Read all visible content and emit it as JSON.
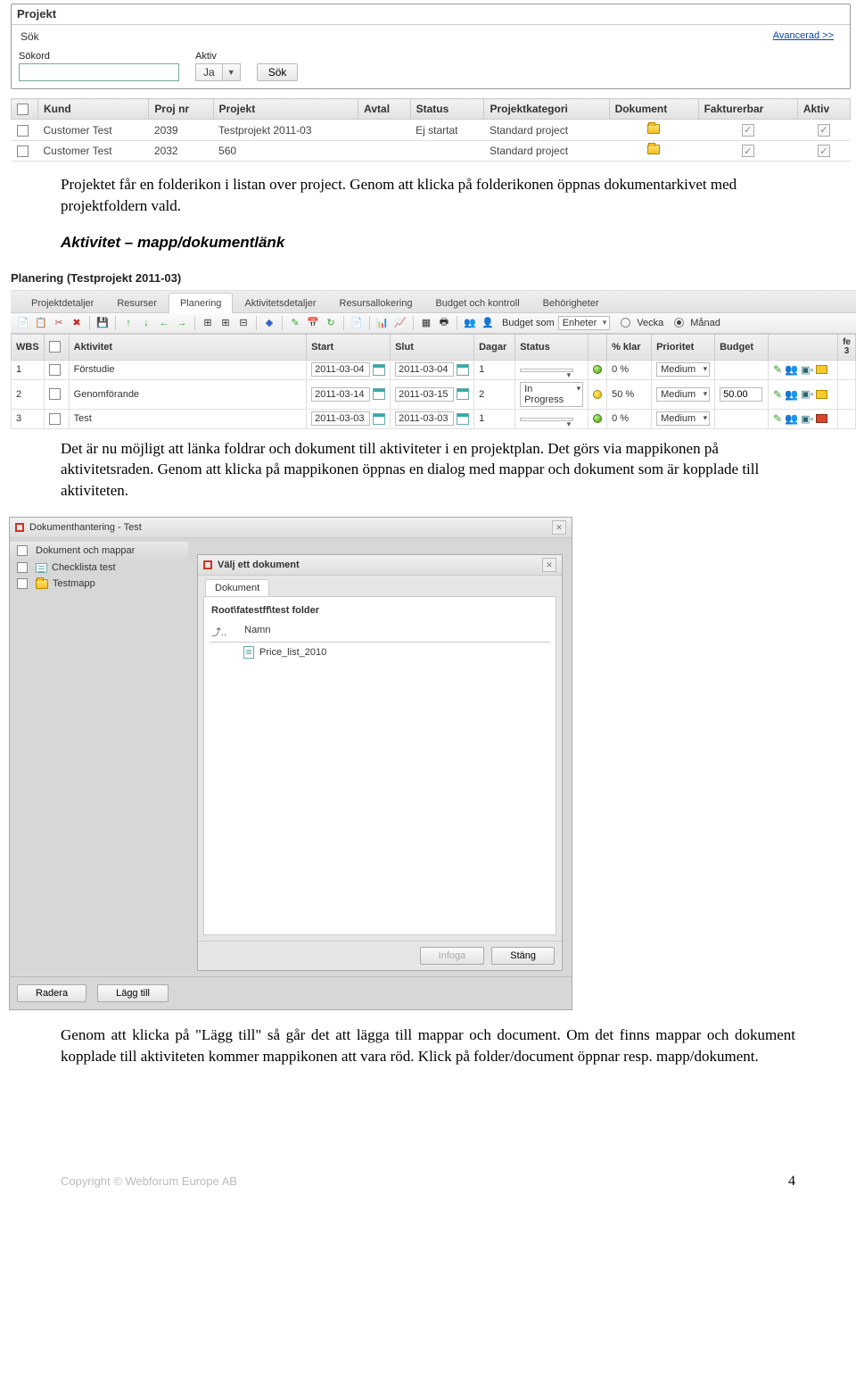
{
  "projekt_panel": {
    "title": "Projekt",
    "search_label": "Sök",
    "advanced_link": "Avancerad >>",
    "fields": {
      "sokord_label": "Sökord",
      "sokord_value": "",
      "aktiv_label": "Aktiv",
      "aktiv_value": "Ja",
      "sok_btn": "Sök"
    }
  },
  "projekt_table": {
    "headers": {
      "kund": "Kund",
      "projnr": "Proj nr",
      "projekt": "Projekt",
      "avtal": "Avtal",
      "status": "Status",
      "projektkategori": "Projektkategori",
      "dokument": "Dokument",
      "fakturerbar": "Fakturerbar",
      "aktiv": "Aktiv"
    },
    "rows": [
      {
        "kund": "Customer Test",
        "projnr": "2039",
        "projekt": "Testprojekt 2011-03",
        "avtal": "",
        "status": "Ej startat",
        "kategori": "Standard project"
      },
      {
        "kund": "Customer Test",
        "projnr": "2032",
        "projekt": "560",
        "avtal": "",
        "status": "",
        "kategori": "Standard project"
      }
    ]
  },
  "para1": "Projektet får en folderikon i listan over project. Genom att klicka på folderikonen öppnas dokumentarkivet med projektfoldern vald.",
  "heading_aktivitet": "Aktivitet – mapp/dokumentlänk",
  "planering": {
    "title": "Planering (Testprojekt 2011-03)",
    "tabs": [
      "Projektdetaljer",
      "Resurser",
      "Planering",
      "Aktivitetsdetaljer",
      "Resursallokering",
      "Budget och kontroll",
      "Behörigheter"
    ],
    "active_tab": 2,
    "toolbar": {
      "budget_label": "Budget som",
      "budget_value": "Enheter",
      "vecka": "Vecka",
      "manad": "Månad"
    },
    "grid": {
      "headers": {
        "wbs": "WBS",
        "aktivitet": "Aktivitet",
        "start": "Start",
        "slut": "Slut",
        "dagar": "Dagar",
        "status": "Status",
        "pklar": "% klar",
        "prioritet": "Prioritet",
        "budget": "Budget",
        "fe": "fe",
        "fe2": "3"
      },
      "rows": [
        {
          "wbs": "1",
          "akt": "Förstudie",
          "start": "2011-03-04",
          "slut": "2011-03-04",
          "dagar": "1",
          "status": "",
          "pklar": "0 %",
          "prio": "Medium",
          "budget": "",
          "folder": "y"
        },
        {
          "wbs": "2",
          "akt": "Genomförande",
          "start": "2011-03-14",
          "slut": "2011-03-15",
          "dagar": "2",
          "status": "In Progress",
          "pklar": "50 %",
          "prio": "Medium",
          "budget": "50.00",
          "folder": "y"
        },
        {
          "wbs": "3",
          "akt": "Test",
          "start": "2011-03-03",
          "slut": "2011-03-03",
          "dagar": "1",
          "status": "",
          "pklar": "0 %",
          "prio": "Medium",
          "budget": "",
          "folder": "r"
        }
      ]
    }
  },
  "para2": "Det är nu möjligt att länka foldrar och dokument till aktiviteter i en projektplan. Det görs via mappikonen på aktivitetsraden. Genom att klicka på mappikonen öppnas en dialog med mappar och dokument som är kopplade till aktiviteten.",
  "dokhantering": {
    "title": "Dokumenthantering - Test",
    "left": {
      "header": "Dokument och mappar",
      "items": [
        "Checklista test",
        "Testmapp"
      ]
    },
    "inner": {
      "title": "Välj ett dokument",
      "tab": "Dokument",
      "breadcrumb": "Root\\fatestff\\test folder",
      "col_up": "⤴..",
      "col_name": "Namn",
      "file": "Price_list_2010",
      "infoga": "Infoga",
      "stang": "Stäng"
    },
    "buttons": {
      "radera": "Radera",
      "lagg_till": "Lägg till"
    }
  },
  "para3": "Genom att klicka på \"Lägg till\" så går det att lägga till mappar och document. Om det finns mappar och dokument kopplade till aktiviteten kommer mappikonen att vara röd. Klick på folder/document öppnar resp. mapp/dokument.",
  "footer": {
    "copyright": "Copyright © Webforum Europe AB",
    "page": "4"
  }
}
